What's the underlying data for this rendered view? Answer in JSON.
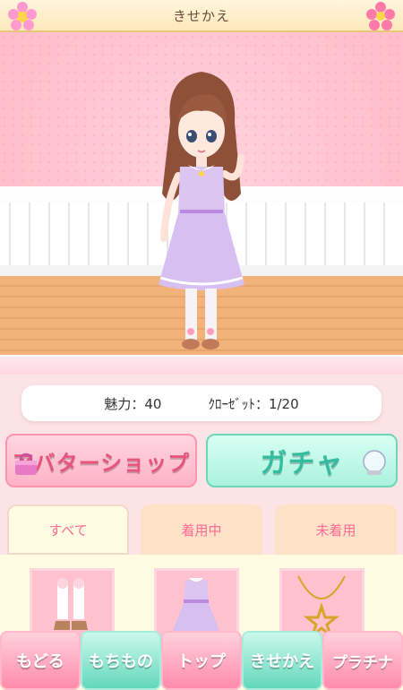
{
  "header": {
    "title": "きせかえ"
  },
  "stats": {
    "charm_label": "魅力：40",
    "closet_label": "ｸﾛｰｾﾞｯﾄ：1/20"
  },
  "buttons": {
    "avatar_shop": "アバターショップ",
    "gacha": "ガチャ"
  },
  "tabs": [
    {
      "label": "すべて"
    },
    {
      "label": "着用中"
    },
    {
      "label": "未着用"
    }
  ],
  "items": [
    {
      "icon": "socks-icon"
    },
    {
      "icon": "dress-icon"
    },
    {
      "icon": "necklace-icon"
    }
  ],
  "nav": [
    {
      "label": "もどる"
    },
    {
      "label": "もちもの"
    },
    {
      "label": "トップ"
    },
    {
      "label": "きせかえ"
    },
    {
      "label": "プラチナ"
    }
  ],
  "colors": {
    "accent_pink": "#ff6b93",
    "mint": "#63d8bc",
    "cream": "#fffbe3"
  }
}
